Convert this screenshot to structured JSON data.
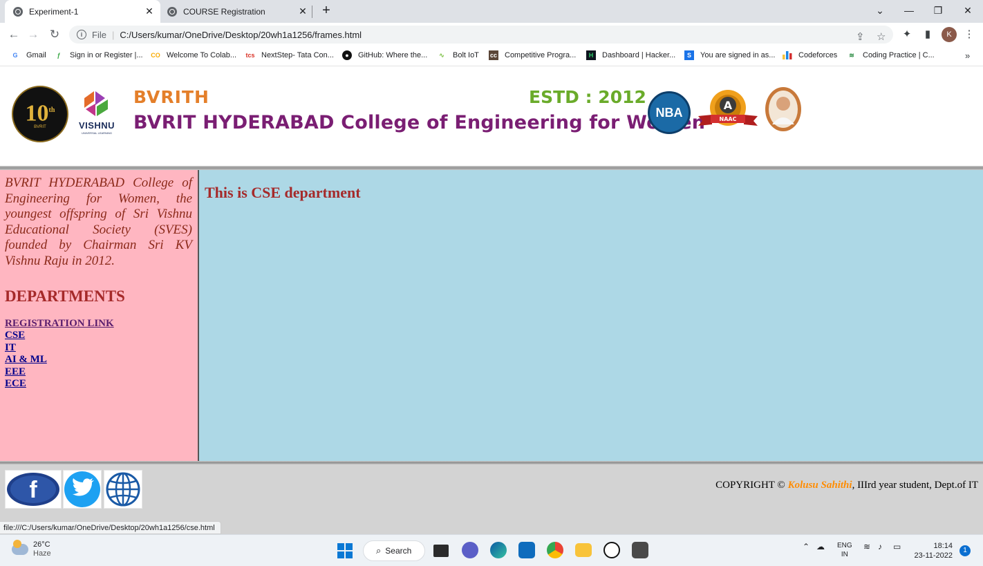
{
  "browser": {
    "tabs": [
      {
        "title": "Experiment-1",
        "active": true
      },
      {
        "title": "COURSE Registration",
        "active": false
      }
    ],
    "url_scheme": "File",
    "url": "C:/Users/kumar/OneDrive/Desktop/20wh1a1256/frames.html",
    "profile_initial": "K",
    "bookmarks": [
      {
        "label": "Gmail",
        "icon": "gmail-icon"
      },
      {
        "label": "Sign in or Register |...",
        "icon": "signin-icon"
      },
      {
        "label": "Welcome To Colab...",
        "icon": "colab-icon"
      },
      {
        "label": "NextStep- Tata Con...",
        "icon": "tcs-icon"
      },
      {
        "label": "GitHub: Where the...",
        "icon": "github-icon"
      },
      {
        "label": "Bolt IoT",
        "icon": "bolt-icon"
      },
      {
        "label": "Competitive Progra...",
        "icon": "cc-icon"
      },
      {
        "label": "Dashboard | Hacker...",
        "icon": "hackerrank-icon"
      },
      {
        "label": "You are signed in as...",
        "icon": "s-icon"
      },
      {
        "label": "Codeforces",
        "icon": "codeforces-icon"
      },
      {
        "label": "Coding Practice | C...",
        "icon": "coding-practice-icon"
      }
    ]
  },
  "header": {
    "logo_number": "10",
    "logo_suffix": "th",
    "logo_caption": "BVRIT",
    "vishnu_label": "VISHNU",
    "vishnu_tagline": "UNIVERSAL LEARNING",
    "short_name": "BVRITH",
    "estd": "ESTD : 2012",
    "college_name": "BVRIT HYDERABAD College of Engineering for Women",
    "nba_label": "NBA",
    "naac_grade": "A",
    "naac_label": "NAAC"
  },
  "sidebar": {
    "about": "BVRIT HYDERABAD College of Engineering for Women, the youngest offspring of Sri Vishnu Educational Society (SVES) founded by Chairman Sri KV Vishnu Raju in 2012.",
    "departments_heading": "DEPARTMENTS",
    "links": [
      "REGISTRATION LINK",
      "CSE",
      "IT",
      "AI & ML",
      "EEE",
      "ECE"
    ]
  },
  "main": {
    "title": "This is CSE department"
  },
  "footer": {
    "copyright_prefix": "COPYRIGHT © ",
    "author": "Kolusu Sahithi",
    "copyright_suffix": ", IIIrd year student, Dept.of IT"
  },
  "status_url": "file:///C:/Users/kumar/OneDrive/Desktop/20wh1a1256/cse.html",
  "taskbar": {
    "temperature": "26°C",
    "condition": "Haze",
    "search_label": "Search",
    "lang_top": "ENG",
    "lang_bottom": "IN",
    "time": "18:14",
    "date": "23-11-2022",
    "notification_count": "1"
  },
  "colors": {
    "sidebar_bg": "#ffb6c1",
    "main_bg": "#add8e6",
    "footer_bg": "#d3d3d3",
    "heading": "#a52a2a",
    "link": "#00008b"
  }
}
